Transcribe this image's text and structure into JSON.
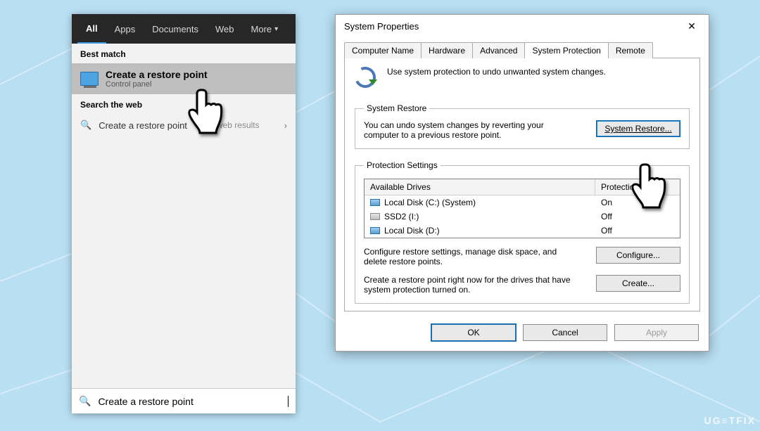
{
  "watermark": "UG≡TFIX",
  "search": {
    "tabs": {
      "all": "All",
      "apps": "Apps",
      "documents": "Documents",
      "web": "Web",
      "more": "More"
    },
    "best_match_header": "Best match",
    "best_match": {
      "title": "Create a restore point",
      "subtitle": "Control panel"
    },
    "web_header": "Search the web",
    "web_item": {
      "text": "Create a restore point",
      "hint": "See web results"
    },
    "input_value": "Create a restore point"
  },
  "dialog": {
    "title": "System Properties",
    "tabs": {
      "computer_name": "Computer Name",
      "hardware": "Hardware",
      "advanced": "Advanced",
      "system_protection": "System Protection",
      "remote": "Remote"
    },
    "intro": "Use system protection to undo unwanted system changes.",
    "restore_group": {
      "legend": "System Restore",
      "text": "You can undo system changes by reverting your computer to a previous restore point.",
      "button": "System Restore..."
    },
    "protection_group": {
      "legend": "Protection Settings",
      "col_drive": "Available Drives",
      "col_protection": "Protection",
      "drives": [
        {
          "name": "Local Disk (C:) (System)",
          "protection": "On",
          "icon": "hdd"
        },
        {
          "name": "SSD2 (I:)",
          "protection": "Off",
          "icon": "ssd"
        },
        {
          "name": "Local Disk (D:)",
          "protection": "Off",
          "icon": "hdd"
        }
      ],
      "configure_text": "Configure restore settings, manage disk space, and delete restore points.",
      "configure_button": "Configure...",
      "create_text": "Create a restore point right now for the drives that have system protection turned on.",
      "create_button": "Create..."
    },
    "buttons": {
      "ok": "OK",
      "cancel": "Cancel",
      "apply": "Apply"
    }
  }
}
